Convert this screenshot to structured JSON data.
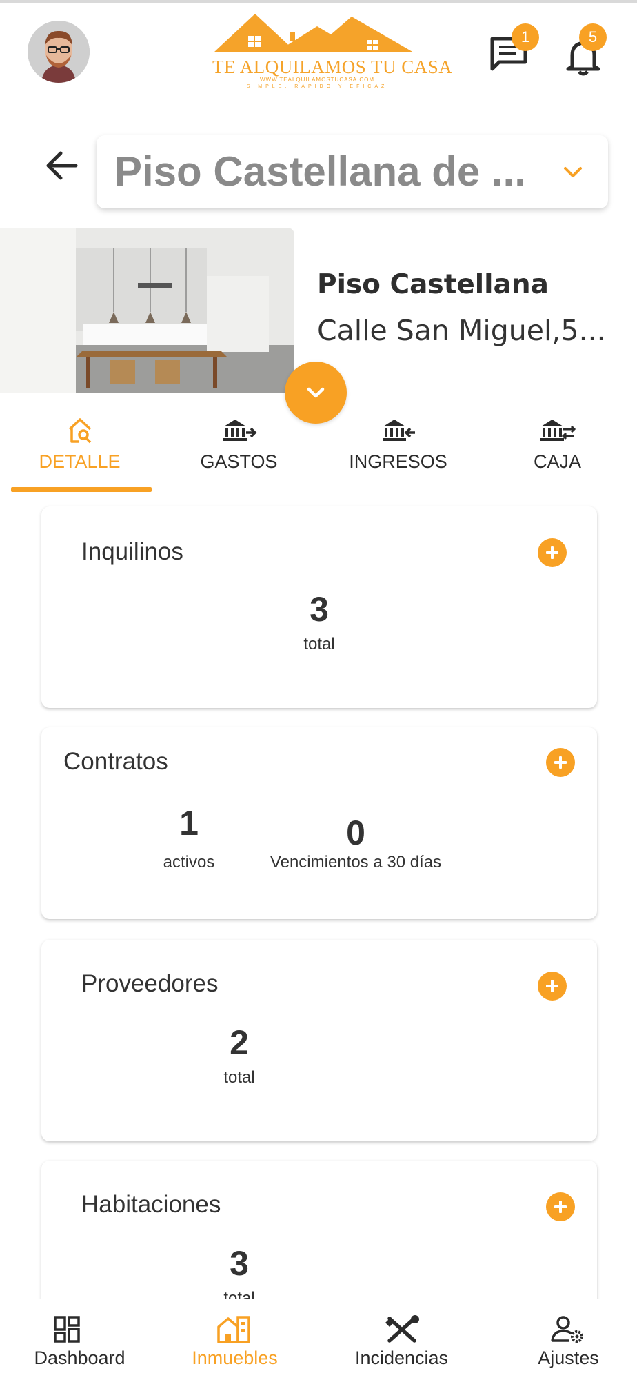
{
  "header": {
    "logo": {
      "title": "TE ALQUILAMOS TU CASA",
      "url": "WWW.TEALQUILAMOSTUCASA.COM",
      "slogan": "SIMPLE, RÁPIDO Y EFICAZ"
    },
    "messages_badge": "1",
    "notifications_badge": "5",
    "accent_color": "#f8a124"
  },
  "property_selector": {
    "value": "Piso Castellana de ..."
  },
  "property": {
    "name": "Piso Castellana",
    "address": "Calle San Miguel,5..."
  },
  "tabs": [
    {
      "label": "DETALLE",
      "icon": "house-search-icon",
      "active": true
    },
    {
      "label": "GASTOS",
      "icon": "bank-out-icon",
      "active": false
    },
    {
      "label": "INGRESOS",
      "icon": "bank-in-icon",
      "active": false
    },
    {
      "label": "CAJA",
      "icon": "bank-exchange-icon",
      "active": false
    }
  ],
  "cards": {
    "inquilinos": {
      "title": "Inquilinos",
      "value": "3",
      "label": "total"
    },
    "contratos": {
      "title": "Contratos",
      "active_value": "1",
      "active_label": "activos",
      "expiring_value": "0",
      "expiring_label": "Vencimientos a 30 días"
    },
    "proveedores": {
      "title": "Proveedores",
      "value": "2",
      "label": "total"
    },
    "habitaciones": {
      "title": "Habitaciones",
      "value": "3",
      "label": "total"
    }
  },
  "bottom_nav": [
    {
      "label": "Dashboard",
      "icon": "dashboard-icon",
      "active": false
    },
    {
      "label": "Inmuebles",
      "icon": "building-icon",
      "active": true
    },
    {
      "label": "Incidencias",
      "icon": "tools-icon",
      "active": false
    },
    {
      "label": "Ajustes",
      "icon": "user-settings-icon",
      "active": false
    }
  ]
}
